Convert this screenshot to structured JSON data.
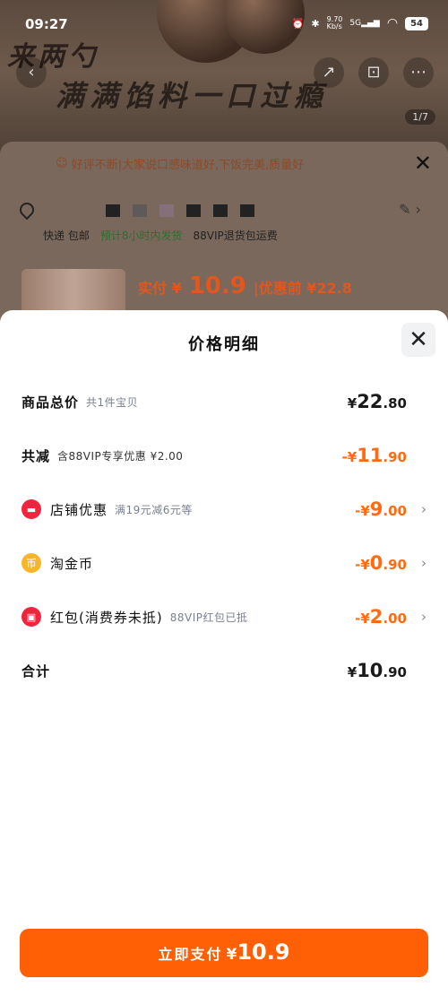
{
  "status_bar": {
    "time": "09:27",
    "net_speed": "9.70",
    "net_unit": "Kb/s",
    "net_type": "5G",
    "battery": "54"
  },
  "background": {
    "hero_text_1": "来两勺",
    "hero_text_2": "满满馅料一口过瘾",
    "page_indicator": "1/7",
    "notice": "好评不断|大家说口感味道好,下饭完美,质量好",
    "delivery_1": "快递 包邮",
    "delivery_2": "预计8小时内发货",
    "delivery_3": "88VIP退货包运费",
    "price_label": "实付 ¥",
    "price_value": "10.9",
    "price_before": "|优惠前 ¥22.8"
  },
  "sheet": {
    "title": "价格明细",
    "rows": [
      {
        "label": "商品总价",
        "sub": "共1件宝贝",
        "currency": "¥",
        "int": "22",
        "dec": ".80"
      },
      {
        "label": "共减",
        "sub": "含88VIP专享优惠 ¥2.00",
        "currency": "-¥",
        "int": "11",
        "dec": ".90"
      },
      {
        "label": "店铺优惠",
        "sub": "满19元减6元等",
        "currency": "-¥",
        "int": "9",
        "dec": ".00"
      },
      {
        "label": "淘金币",
        "sub": "",
        "currency": "-¥",
        "int": "0",
        "dec": ".90"
      },
      {
        "label": "红包(消费券未抵)",
        "sub": "88VIP红包已抵",
        "currency": "-¥",
        "int": "2",
        "dec": ".00"
      },
      {
        "label": "合计",
        "sub": "",
        "currency": "¥",
        "int": "10",
        "dec": ".90"
      }
    ],
    "coin_glyph": "币"
  },
  "pay_button": {
    "label": "立即支付",
    "currency": "¥",
    "amount": "10.9"
  },
  "colors": {
    "accent": "#ff6005",
    "discount": "#ff6a13",
    "red_icon": "#f0243c",
    "gold_icon": "#f7b52a"
  }
}
